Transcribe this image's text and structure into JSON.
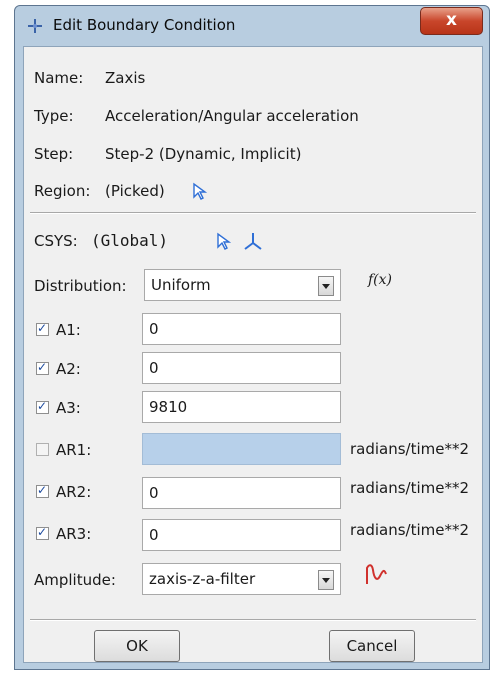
{
  "window": {
    "title": "Edit Boundary Condition",
    "close_label": "x"
  },
  "info": {
    "name_label": "Name:",
    "name_value": "Zaxis",
    "type_label": "Type:",
    "type_value": "Acceleration/Angular acceleration",
    "step_label": "Step:",
    "step_value": "Step-2 (Dynamic, Implicit)",
    "region_label": "Region:",
    "region_value": "(Picked)"
  },
  "csys": {
    "label": "CSYS:",
    "value": "(Global)"
  },
  "distribution": {
    "label": "Distribution:",
    "value": "Uniform",
    "fx_label": "f(x)"
  },
  "components": [
    {
      "label": "A1:",
      "checked": true,
      "value": "0",
      "unit": ""
    },
    {
      "label": "A2:",
      "checked": true,
      "value": "0",
      "unit": ""
    },
    {
      "label": "A3:",
      "checked": true,
      "value": "9810",
      "unit": ""
    },
    {
      "label": "AR1:",
      "checked": false,
      "value": "",
      "unit": "radians/time**2"
    },
    {
      "label": "AR2:",
      "checked": true,
      "value": "0",
      "unit": "radians/time**2"
    },
    {
      "label": "AR3:",
      "checked": true,
      "value": "0",
      "unit": "radians/time**2"
    }
  ],
  "amplitude": {
    "label": "Amplitude:",
    "value": "zaxis-z-a-filter"
  },
  "buttons": {
    "ok": "OK",
    "cancel": "Cancel"
  },
  "colors": {
    "accent": "#2f6fd6",
    "disabled_field": "#b7d0ea",
    "close_button": "#c9462b",
    "amplitude_icon": "#d0312d"
  }
}
